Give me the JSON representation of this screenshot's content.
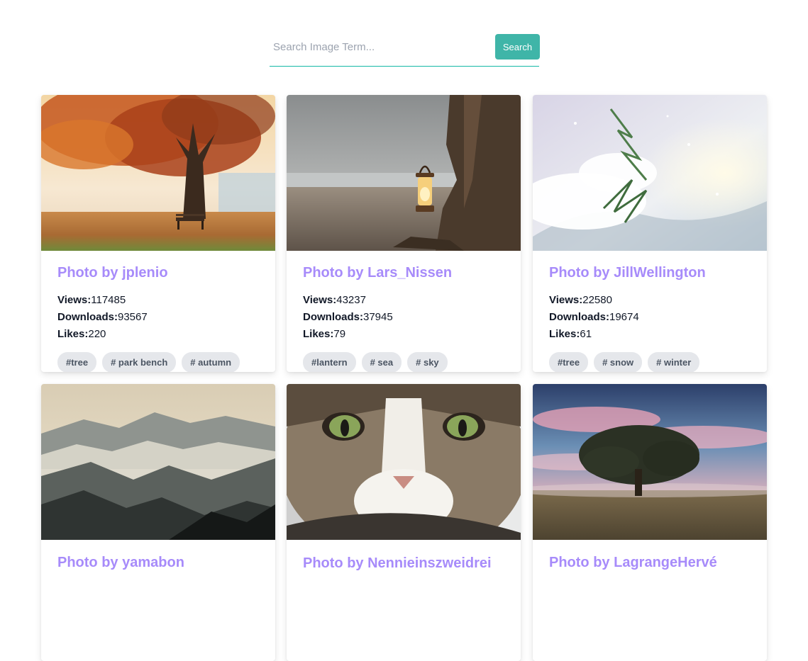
{
  "search": {
    "placeholder": "Search Image Term...",
    "button_label": "Search",
    "accent_color": "#3fb5a8"
  },
  "stat_labels": {
    "views": "Views:",
    "downloads": "Downloads:",
    "likes": "Likes:"
  },
  "cards": [
    {
      "title": "Photo by jplenio",
      "image_subject": "autumn-tree-with-park-bench",
      "views": "117485",
      "downloads": "93567",
      "likes": "220",
      "tags": [
        "#tree",
        "# park bench",
        "# autumn"
      ]
    },
    {
      "title": "Photo by Lars_Nissen",
      "image_subject": "lantern-on-beach",
      "views": "43237",
      "downloads": "37945",
      "likes": "79",
      "tags": [
        "#lantern",
        "# sea",
        "# sky"
      ]
    },
    {
      "title": "Photo by JillWellington",
      "image_subject": "snowy-tree-branch",
      "views": "22580",
      "downloads": "19674",
      "likes": "61",
      "tags": [
        "#tree",
        "# snow",
        "# winter"
      ]
    },
    {
      "title": "Photo by yamabon",
      "image_subject": "misty-mountains"
    },
    {
      "title": "Photo by Nennieinszweidrei",
      "image_subject": "cat-face-closeup"
    },
    {
      "title": "Photo by LagrangeHervé",
      "image_subject": "lone-tree-at-sunset"
    }
  ]
}
